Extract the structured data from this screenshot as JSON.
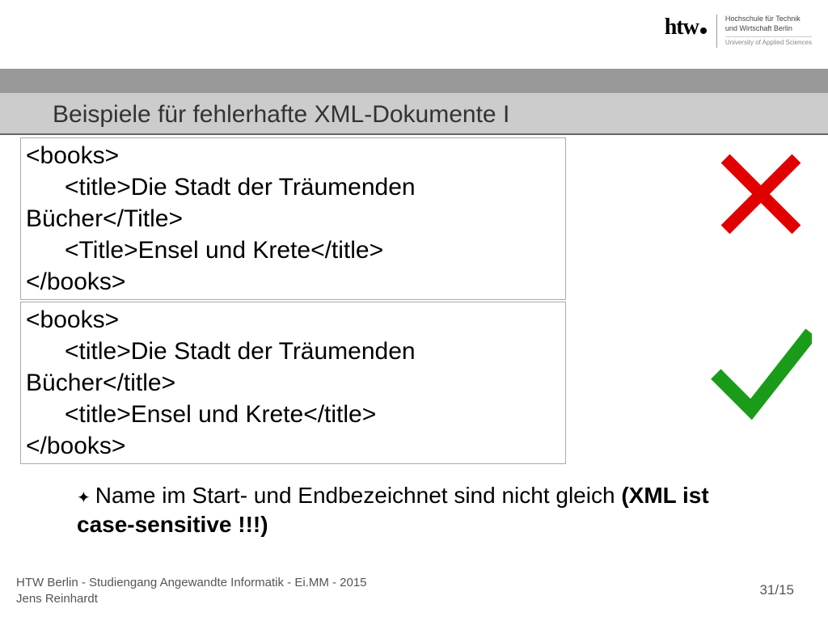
{
  "logo": {
    "brand": "htw",
    "line1": "Hochschule für Technik",
    "line2": "und Wirtschaft Berlin",
    "sub": "University of Applied Sciences"
  },
  "title": "Beispiele für fehlerhafte XML-Dokumente I",
  "bad": {
    "l1": "<books>",
    "l2": "<title>Die Stadt der Träumenden",
    "l3": "Bücher</Title>",
    "l4": "<Title>Ensel und Krete</title>",
    "l5": "</books>"
  },
  "good": {
    "l1": "<books>",
    "l2": "<title>Die Stadt der Träumenden",
    "l3": "Bücher</title>",
    "l4": "<title>Ensel und Krete</title>",
    "l5": "</books>"
  },
  "note": {
    "pre": "Name im Start- und Endbezeichnet sind nicht gleich ",
    "bold": "(XML ist case-sensitive !!!)"
  },
  "footer": {
    "l1": "HTW Berlin - Studiengang Angewandte Informatik - Ei.MM - 2015",
    "l2": "Jens Reinhardt"
  },
  "page": "31/15"
}
